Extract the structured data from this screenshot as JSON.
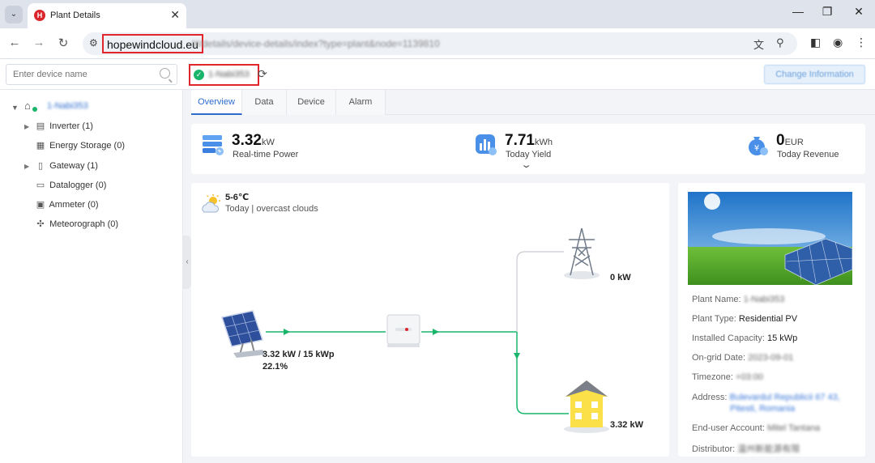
{
  "browser": {
    "tab_title": "Plant Details",
    "url_host": "hopewindcloud.eu",
    "url_path": "/#/details/device-details/index?type=plant&node=1139810"
  },
  "header": {
    "search_placeholder": "Enter device name",
    "plant_name": "1-Nabi353",
    "change_button": "Change Information"
  },
  "sidebar": {
    "root": "1-Nabi353",
    "items": [
      {
        "label": "Inverter (1)",
        "expandable": true,
        "icon": "inverter-icon"
      },
      {
        "label": "Energy Storage (0)",
        "expandable": false,
        "icon": "storage-icon"
      },
      {
        "label": "Gateway (1)",
        "expandable": true,
        "icon": "gateway-icon"
      },
      {
        "label": "Datalogger (0)",
        "expandable": false,
        "icon": "datalogger-icon"
      },
      {
        "label": "Ammeter (0)",
        "expandable": false,
        "icon": "ammeter-icon"
      },
      {
        "label": "Meteorograph (0)",
        "expandable": false,
        "icon": "meteorograph-icon"
      }
    ]
  },
  "tabs": [
    "Overview",
    "Data",
    "Device",
    "Alarm"
  ],
  "kpis": [
    {
      "value": "3.32",
      "unit": "kW",
      "label": "Real-time Power"
    },
    {
      "value": "7.71",
      "unit": "kWh",
      "label": "Today Yield"
    },
    {
      "value": "0",
      "unit": "EUR",
      "label": "Today Revenue"
    }
  ],
  "weather": {
    "temp": "5-6℃",
    "desc": "Today | overcast clouds"
  },
  "flow": {
    "pv_power": "3.32 kW / 15 kWp",
    "pv_percent": "22.1%",
    "grid_power": "0 kW",
    "load_power": "3.32 kW"
  },
  "info": [
    {
      "key": "Plant Name:",
      "value": "1-Nabi353",
      "style": "blur"
    },
    {
      "key": "Plant Type:",
      "value": "Residential PV",
      "style": "plain"
    },
    {
      "key": "Installed Capacity:",
      "value": "15 kWp",
      "style": "plain"
    },
    {
      "key": "On-grid Date:",
      "value": "2023-09-01",
      "style": "blur"
    },
    {
      "key": "Timezone:",
      "value": "+03:00",
      "style": "blur"
    },
    {
      "key": "Address:",
      "value": "Bulevardul Republicii 67 43,",
      "value2": "Pitesti, Romania",
      "style": "blur-link"
    },
    {
      "key": "End-user Account:",
      "value": "Mitel Tantana",
      "style": "blur"
    },
    {
      "key": "Distributor:",
      "value": "温州新能源有限",
      "style": "blur"
    }
  ],
  "colors": {
    "accent": "#2d6ccd",
    "flow": "#19b56b",
    "highlight": "#e0262b"
  }
}
